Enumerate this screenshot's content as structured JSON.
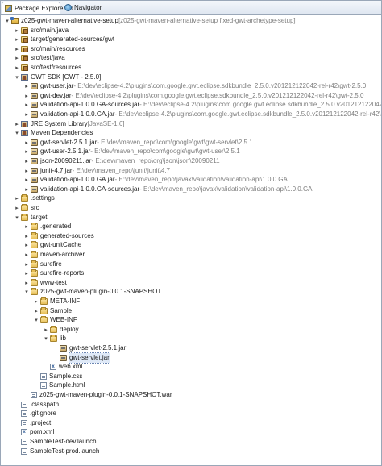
{
  "tabs": [
    {
      "label": "Package Explorer",
      "close": "✕",
      "active": true,
      "icon": "package-explorer-icon"
    },
    {
      "label": "Navigator",
      "active": false,
      "icon": "navigator-icon"
    }
  ],
  "tree": [
    {
      "depth": 0,
      "tw": "▾",
      "icon": "project",
      "label": "z025-gwt-maven-alternative-setup",
      "dec": "[z025-gwt-maven-alternative-setup fixed-gwt-archetype-setup]"
    },
    {
      "depth": 1,
      "tw": "▸",
      "icon": "srcfolder",
      "label": "src/main/java"
    },
    {
      "depth": 1,
      "tw": "▸",
      "icon": "srcfolder",
      "label": "target/generated-sources/gwt"
    },
    {
      "depth": 1,
      "tw": "▸",
      "icon": "srcfolder",
      "label": "src/main/resources"
    },
    {
      "depth": 1,
      "tw": "▸",
      "icon": "srcfolder",
      "label": "src/test/java"
    },
    {
      "depth": 1,
      "tw": "▸",
      "icon": "srcfolder",
      "label": "src/test/resources"
    },
    {
      "depth": 1,
      "tw": "▾",
      "icon": "library",
      "label": "GWT SDK [GWT - 2.5.0]"
    },
    {
      "depth": 2,
      "tw": "▸",
      "icon": "jar",
      "label": "gwt-user.jar",
      "dec": " - E:\\dev\\eclipse-4.2\\plugins\\com.google.gwt.eclipse.sdkbundle_2.5.0.v201212122042-rel-r42\\gwt-2.5.0"
    },
    {
      "depth": 2,
      "tw": "▸",
      "icon": "jar",
      "label": "gwt-dev.jar",
      "dec": " - E:\\dev\\eclipse-4.2\\plugins\\com.google.gwt.eclipse.sdkbundle_2.5.0.v201212122042-rel-r42\\gwt-2.5.0"
    },
    {
      "depth": 2,
      "tw": "▸",
      "icon": "jar",
      "label": "validation-api-1.0.0.GA-sources.jar",
      "dec": " - E:\\dev\\eclipse-4.2\\plugins\\com.google.gwt.eclipse.sdkbundle_2.5.0.v201212122042-rel-r42\\gwt-2.5.0"
    },
    {
      "depth": 2,
      "tw": "▸",
      "icon": "jar",
      "label": "validation-api-1.0.0.GA.jar",
      "dec": " - E:\\dev\\eclipse-4.2\\plugins\\com.google.gwt.eclipse.sdkbundle_2.5.0.v201212122042-rel-r42\\gwt-2.5.0"
    },
    {
      "depth": 1,
      "tw": "▸",
      "icon": "library",
      "label": "JRE System Library",
      "dec": " [JavaSE-1.6]"
    },
    {
      "depth": 1,
      "tw": "▾",
      "icon": "library",
      "label": "Maven Dependencies"
    },
    {
      "depth": 2,
      "tw": "▸",
      "icon": "jar",
      "label": "gwt-servlet-2.5.1.jar",
      "dec": " - E:\\dev\\maven_repo\\com\\google\\gwt\\gwt-servlet\\2.5.1"
    },
    {
      "depth": 2,
      "tw": "▸",
      "icon": "jar",
      "label": "gwt-user-2.5.1.jar",
      "dec": " - E:\\dev\\maven_repo\\com\\google\\gwt\\gwt-user\\2.5.1"
    },
    {
      "depth": 2,
      "tw": "▸",
      "icon": "jar",
      "label": "json-20090211.jar",
      "dec": " - E:\\dev\\maven_repo\\org\\json\\json\\20090211"
    },
    {
      "depth": 2,
      "tw": "▸",
      "icon": "jar",
      "label": "junit-4.7.jar",
      "dec": " - E:\\dev\\maven_repo\\junit\\junit\\4.7"
    },
    {
      "depth": 2,
      "tw": "▸",
      "icon": "jar",
      "label": "validation-api-1.0.0.GA.jar",
      "dec": " - E:\\dev\\maven_repo\\javax\\validation\\validation-api\\1.0.0.GA"
    },
    {
      "depth": 2,
      "tw": "▸",
      "icon": "jar",
      "label": "validation-api-1.0.0.GA-sources.jar",
      "dec": " - E:\\dev\\maven_repo\\javax\\validation\\validation-api\\1.0.0.GA"
    },
    {
      "depth": 1,
      "tw": "▸",
      "icon": "folder",
      "label": ".settings"
    },
    {
      "depth": 1,
      "tw": "▸",
      "icon": "folder",
      "label": "src"
    },
    {
      "depth": 1,
      "tw": "▾",
      "icon": "folder",
      "label": "target"
    },
    {
      "depth": 2,
      "tw": "▸",
      "icon": "folder",
      "label": ".generated"
    },
    {
      "depth": 2,
      "tw": "▸",
      "icon": "folder",
      "label": "generated-sources"
    },
    {
      "depth": 2,
      "tw": "▸",
      "icon": "folder",
      "label": "gwt-unitCache"
    },
    {
      "depth": 2,
      "tw": "▸",
      "icon": "folder",
      "label": "maven-archiver"
    },
    {
      "depth": 2,
      "tw": "▸",
      "icon": "folder",
      "label": "surefire"
    },
    {
      "depth": 2,
      "tw": "▸",
      "icon": "folder",
      "label": "surefire-reports"
    },
    {
      "depth": 2,
      "tw": "▸",
      "icon": "folder",
      "label": "www-test"
    },
    {
      "depth": 2,
      "tw": "▾",
      "icon": "folder",
      "label": "z025-gwt-maven-plugin-0.0.1-SNAPSHOT"
    },
    {
      "depth": 3,
      "tw": "▸",
      "icon": "folder",
      "label": "META-INF"
    },
    {
      "depth": 3,
      "tw": "▸",
      "icon": "folder",
      "label": "Sample"
    },
    {
      "depth": 3,
      "tw": "▾",
      "icon": "folder",
      "label": "WEB-INF"
    },
    {
      "depth": 4,
      "tw": "▸",
      "icon": "folder",
      "label": "deploy"
    },
    {
      "depth": 4,
      "tw": "▾",
      "icon": "folder",
      "label": "lib"
    },
    {
      "depth": 5,
      "tw": "",
      "icon": "jar",
      "label": "gwt-servlet-2.5.1.jar"
    },
    {
      "depth": 5,
      "tw": "",
      "icon": "jar",
      "label": "gwt-servlet.jar",
      "selected": true
    },
    {
      "depth": 4,
      "tw": "",
      "icon": "xml",
      "label": "web.xml"
    },
    {
      "depth": 3,
      "tw": "",
      "icon": "file",
      "label": "Sample.css"
    },
    {
      "depth": 3,
      "tw": "",
      "icon": "file",
      "label": "Sample.html"
    },
    {
      "depth": 2,
      "tw": "",
      "icon": "file",
      "label": "z025-gwt-maven-plugin-0.0.1-SNAPSHOT.war"
    },
    {
      "depth": 1,
      "tw": "",
      "icon": "file",
      "label": ".classpath"
    },
    {
      "depth": 1,
      "tw": "",
      "icon": "file",
      "label": ".gitignore"
    },
    {
      "depth": 1,
      "tw": "",
      "icon": "file",
      "label": ".project"
    },
    {
      "depth": 1,
      "tw": "",
      "icon": "xml",
      "label": "pom.xml"
    },
    {
      "depth": 1,
      "tw": "",
      "icon": "file",
      "label": "SampleTest-dev.launch"
    },
    {
      "depth": 1,
      "tw": "",
      "icon": "file",
      "label": "SampleTest-prod.launch"
    }
  ]
}
